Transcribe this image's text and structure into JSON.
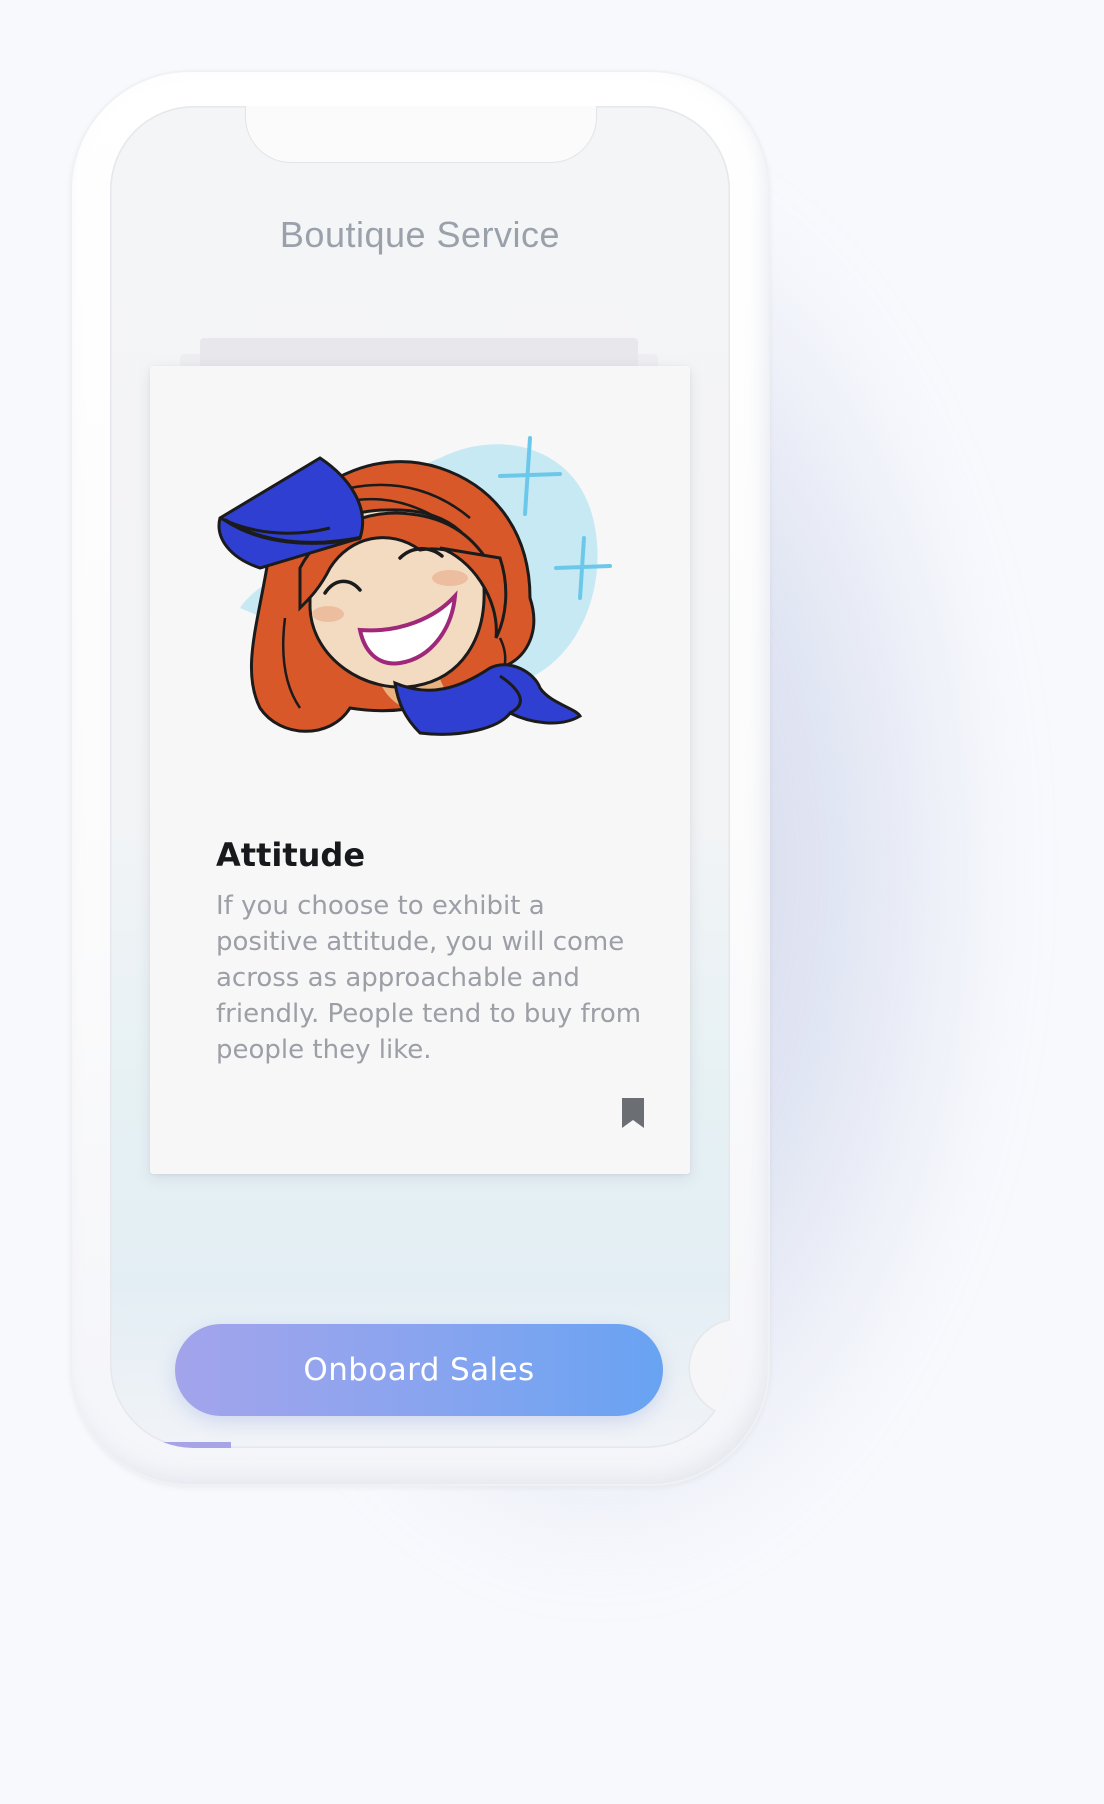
{
  "screen": {
    "title": "Boutique Service"
  },
  "card": {
    "illustration": "smiling-flight-attendant-illustration",
    "title": "Attitude",
    "body": "If you choose to exhibit a positive attitude, you will come across as approachable and friendly. People tend to buy from people they like.",
    "bookmark_icon": "bookmark-icon"
  },
  "actions": {
    "primary_label": "Onboard Sales"
  },
  "progress": {
    "fraction": 0.15,
    "color": "#a6a4e6"
  },
  "colors": {
    "cta_start": "#a3a4eb",
    "cta_end": "#68a3f2",
    "hat_scarf": "#2f3fd1",
    "hair": "#d9582a",
    "sparkle_bg": "#c7e9f3"
  }
}
